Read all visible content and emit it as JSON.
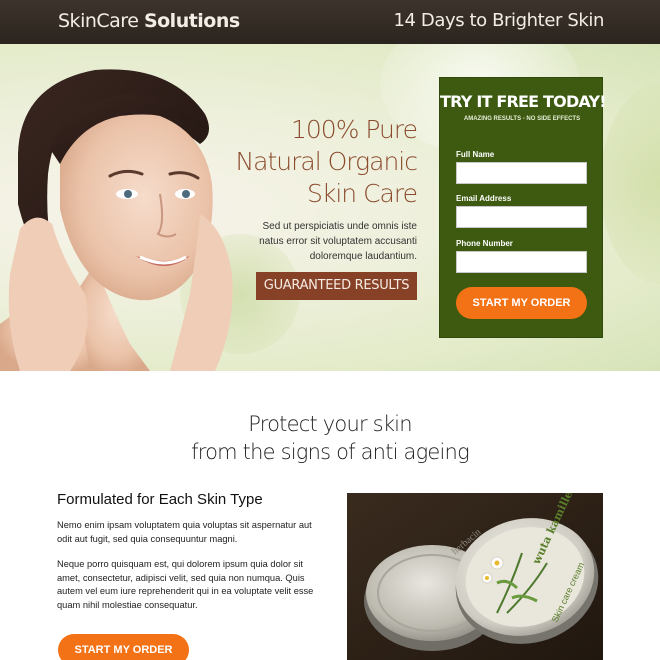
{
  "header": {
    "brand_light": "SkinCare",
    "brand_bold": "Solutions",
    "tagline": "14 Days to Brighter Skin"
  },
  "hero": {
    "headline": [
      "100% Pure",
      "Natural Organic",
      "Skin Care"
    ],
    "body": "Sed ut perspiciatis unde omnis iste natus error sit voluptatem accusanti doloremque laudantium.",
    "guarantee_label": "GUARANTEED RESULTS"
  },
  "form": {
    "title": "TRY IT FREE TODAY!",
    "subtitle": "AMAZING RESULTS - NO SIDE EFFECTS",
    "fields": [
      {
        "label": "Full Name",
        "value": "",
        "placeholder": ""
      },
      {
        "label": "Email Address",
        "value": "",
        "placeholder": ""
      },
      {
        "label": "Phone Number",
        "value": "",
        "placeholder": ""
      }
    ],
    "submit_label": "START MY ORDER"
  },
  "section": {
    "heading": [
      "Protect your skin",
      "from the signs of anti ageing"
    ],
    "feature_title": "Formulated for Each Skin Type",
    "paragraphs": [
      "Nemo enim ipsam voluptatem quia voluptas sit aspernatur aut odit aut fugit, sed quia consequuntur magni.",
      "Neque porro quisquam est, qui dolorem ipsum quia dolor sit amet, consectetur, adipisci velit, sed quia non numqua. Quis autem vel eum iure reprehenderit qui in ea voluptate velit esse quam nihil molestiae consequatur."
    ],
    "cta_label": "START MY ORDER"
  },
  "product": {
    "tin_label_top": "herbacin",
    "tin_label_name": "wuta kamille",
    "tin_label_bottom": "Skin care cream"
  },
  "colors": {
    "header_bg": "#2f2822",
    "accent_brown": "#874126",
    "form_green": "#3d5a10",
    "cta_orange": "#f47216"
  },
  "icons": {
    "portrait": "woman-portrait-image",
    "product": "cream-tin-image"
  }
}
